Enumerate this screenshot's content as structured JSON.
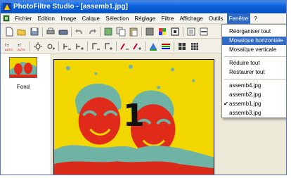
{
  "window": {
    "title": "PhotoFiltre Studio - [assemb1.jpg]"
  },
  "menubar": {
    "items": [
      "Fichier",
      "Edition",
      "Image",
      "Calque",
      "Sélection",
      "Réglage",
      "Filtre",
      "Affichage",
      "Outils",
      "Fenêtre",
      "?"
    ],
    "active": "Fenêtre"
  },
  "thumbnails": [
    {
      "label": "Fond"
    }
  ],
  "fenetre_menu": {
    "items": [
      {
        "label": "Réorganiser tout"
      },
      {
        "label": "Mosaïque horizontale",
        "highlighted": true
      },
      {
        "label": "Mosaïque verticale"
      },
      {
        "label": "Réduire tout"
      },
      {
        "label": "Restaurer tout"
      },
      {
        "label": "assemb4.jpg"
      },
      {
        "label": "assemb2.jpg"
      },
      {
        "label": "assemb1.jpg",
        "checked": true
      },
      {
        "label": "assemb3.jpg"
      }
    ]
  },
  "document": {
    "overlay_text": "1"
  },
  "colors": {
    "titlebar": "#0a5fd8",
    "menu_highlight": "#316ac5",
    "photo_yellow": "#f2d600",
    "photo_red": "#e02a1a",
    "photo_teal": "#6fb3a5"
  },
  "icons": [
    "app-logo",
    "new",
    "open",
    "save",
    "print",
    "undo",
    "redo",
    "layers",
    "zoom",
    "color-picker",
    "brush"
  ]
}
